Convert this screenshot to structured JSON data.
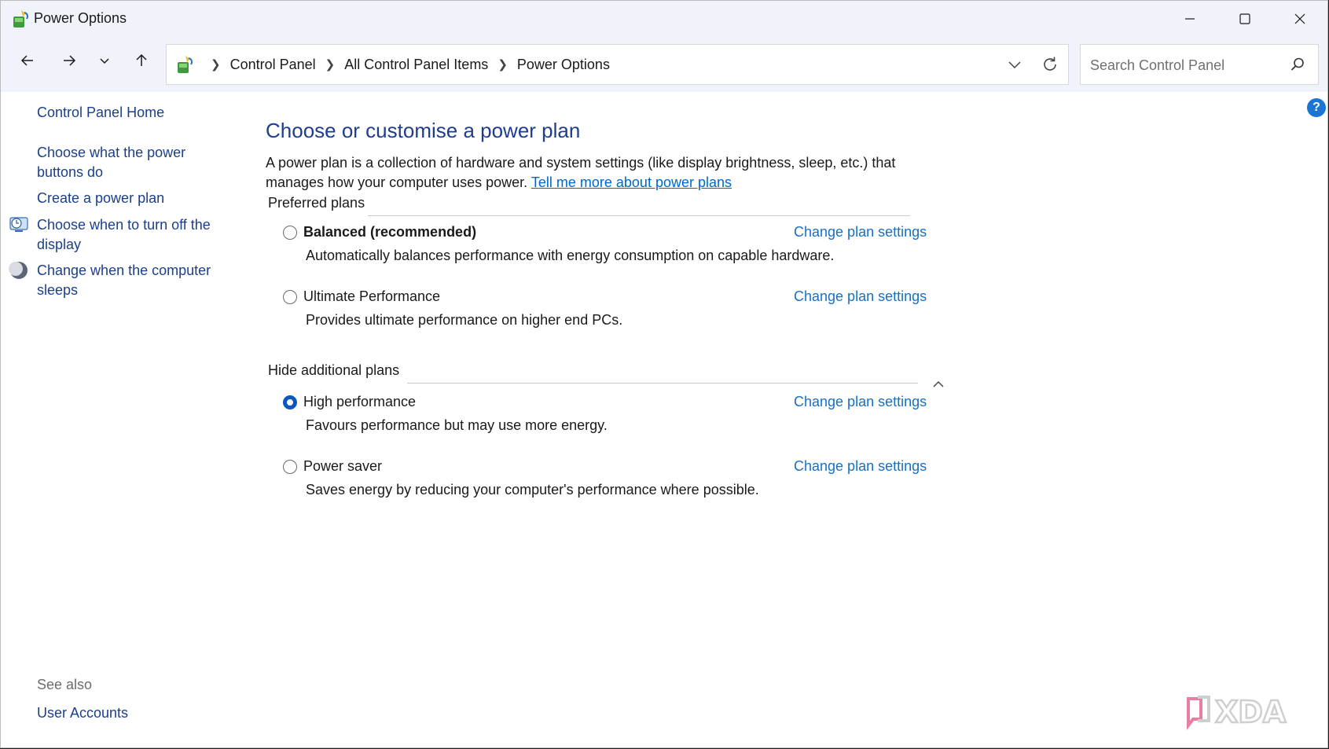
{
  "window": {
    "title": "Power Options",
    "controls": {
      "minimize": "minimize",
      "maximize": "maximize",
      "close": "close"
    }
  },
  "navigation": {
    "breadcrumbs": [
      "Control Panel",
      "All Control Panel Items",
      "Power Options"
    ],
    "search_placeholder": "Search Control Panel"
  },
  "help": {
    "label": "?"
  },
  "sidebar": {
    "home": "Control Panel Home",
    "links": [
      {
        "label": "Choose what the power buttons do",
        "icon": null
      },
      {
        "label": "Create a power plan",
        "icon": null
      },
      {
        "label": "Choose when to turn off the display",
        "icon": "display-clock-icon"
      },
      {
        "label": "Change when the computer sleeps",
        "icon": "moon-icon"
      }
    ],
    "see_also": {
      "heading": "See also",
      "links": [
        "User Accounts"
      ]
    }
  },
  "main": {
    "heading": "Choose or customise a power plan",
    "description": "A power plan is a collection of hardware and system settings (like display brightness, sleep, etc.) that manages how your computer uses power.",
    "learn_more_link": "Tell me more about power plans",
    "preferred": {
      "label": "Preferred plans",
      "plans": [
        {
          "name": "Balanced (recommended)",
          "description": "Automatically balances performance with energy consumption on capable hardware.",
          "selected": false,
          "bold": true,
          "action": "Change plan settings"
        },
        {
          "name": "Ultimate Performance",
          "description": "Provides ultimate performance on higher end PCs.",
          "selected": false,
          "bold": false,
          "action": "Change plan settings"
        }
      ]
    },
    "additional": {
      "label": "Hide additional plans",
      "plans": [
        {
          "name": "High performance",
          "description": "Favours performance but may use more energy.",
          "selected": true,
          "bold": false,
          "action": "Change plan settings"
        },
        {
          "name": "Power saver",
          "description": "Saves energy by reducing your computer's performance where possible.",
          "selected": false,
          "bold": false,
          "action": "Change plan settings"
        }
      ]
    }
  },
  "watermark": {
    "text": "XDA"
  },
  "colors": {
    "accent": "#0b57c4",
    "link": "#1a6fc4",
    "heading": "#1e3d8f",
    "sidebar_link": "#1b3f8c"
  }
}
